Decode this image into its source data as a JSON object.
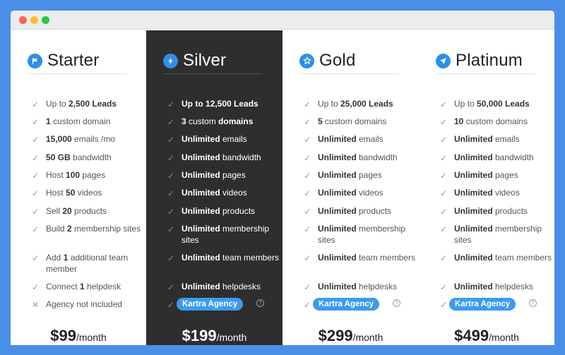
{
  "colors": {
    "background": "#4a8fe7",
    "accent": "#2d8fe6",
    "dark_column": "#2e2e2e"
  },
  "plans": [
    {
      "name": "Starter",
      "icon": "flag-icon",
      "price": "$99",
      "period": "/month",
      "features": [
        {
          "icon": "check-icon",
          "pre": "Up to ",
          "bold": "2,500 Leads",
          "post": ""
        },
        {
          "icon": "check-icon",
          "pre": "",
          "bold": "1",
          "post": " custom domain"
        },
        {
          "icon": "check-icon",
          "pre": "",
          "bold": "15,000",
          "post": " emails /mo"
        },
        {
          "icon": "check-icon",
          "pre": "",
          "bold": "50 GB",
          "post": " bandwidth"
        },
        {
          "icon": "check-icon",
          "pre": "Host ",
          "bold": "100",
          "post": " pages"
        },
        {
          "icon": "check-icon",
          "pre": "Host ",
          "bold": "50",
          "post": " videos"
        },
        {
          "icon": "check-icon",
          "pre": "Sell ",
          "bold": "20",
          "post": " products"
        },
        {
          "icon": "check-icon",
          "pre": "Build ",
          "bold": "2",
          "post": " membership sites"
        },
        {
          "icon": "check-icon",
          "pre": "Add ",
          "bold": "1",
          "post": " additional team member"
        },
        {
          "icon": "check-icon",
          "pre": "Connect ",
          "bold": "1",
          "post": " helpdesk"
        },
        {
          "icon": "cross-icon",
          "pre": "Agency not included",
          "bold": "",
          "post": ""
        }
      ]
    },
    {
      "name": "Silver",
      "icon": "bolt-icon",
      "price": "$199",
      "period": "/month",
      "features": [
        {
          "icon": "check-icon",
          "pre": "",
          "bold": "Up to 12,500 Leads",
          "post": ""
        },
        {
          "icon": "check-icon",
          "pre": "",
          "bold": "3",
          "post": " custom ",
          "bold2": "domains"
        },
        {
          "icon": "check-icon",
          "pre": "",
          "bold": "Unlimited",
          "post": " emails"
        },
        {
          "icon": "check-icon",
          "pre": "",
          "bold": "Unlimited",
          "post": " bandwidth"
        },
        {
          "icon": "check-icon",
          "pre": "",
          "bold": "Unlimited",
          "post": " pages"
        },
        {
          "icon": "check-icon",
          "pre": "",
          "bold": "Unlimited",
          "post": " videos"
        },
        {
          "icon": "check-icon",
          "pre": "",
          "bold": "Unlimited",
          "post": " products"
        },
        {
          "icon": "check-icon",
          "pre": "",
          "bold": "Unlimited",
          "post": " membership sites"
        },
        {
          "icon": "check-icon",
          "pre": "",
          "bold": "Unlimited",
          "post": " team members"
        },
        {
          "icon": "check-icon",
          "pre": "",
          "bold": "Unlimited",
          "post": " helpdesks"
        }
      ],
      "agency": "Kartra Agency"
    },
    {
      "name": "Gold",
      "icon": "star-icon",
      "price": "$299",
      "period": "/month",
      "features": [
        {
          "icon": "check-icon",
          "pre": "Up to ",
          "bold": "25,000 Leads",
          "post": ""
        },
        {
          "icon": "check-icon",
          "pre": "",
          "bold": "5",
          "post": " custom domains"
        },
        {
          "icon": "check-icon",
          "pre": "",
          "bold": "Unlimited",
          "post": " emails"
        },
        {
          "icon": "check-icon",
          "pre": "",
          "bold": "Unlimited",
          "post": " bandwidth"
        },
        {
          "icon": "check-icon",
          "pre": "",
          "bold": "Unlimited",
          "post": " pages"
        },
        {
          "icon": "check-icon",
          "pre": "",
          "bold": "Unlimited",
          "post": " videos"
        },
        {
          "icon": "check-icon",
          "pre": "",
          "bold": "Unlimited",
          "post": " products"
        },
        {
          "icon": "check-icon",
          "pre": "",
          "bold": "Unlimited",
          "post": " membership sites"
        },
        {
          "icon": "check-icon",
          "pre": "",
          "bold": "Unlimited",
          "post": " team members"
        },
        {
          "icon": "check-icon",
          "pre": "",
          "bold": "Unlimited",
          "post": " helpdesks"
        }
      ],
      "agency": "Kartra Agency"
    },
    {
      "name": "Platinum",
      "icon": "rocket-icon",
      "price": "$499",
      "period": "/month",
      "features": [
        {
          "icon": "check-icon",
          "pre": "Up to ",
          "bold": "50,000 Leads",
          "post": ""
        },
        {
          "icon": "check-icon",
          "pre": "",
          "bold": "10",
          "post": " custom domains"
        },
        {
          "icon": "check-icon",
          "pre": "",
          "bold": "Unlimited",
          "post": " emails"
        },
        {
          "icon": "check-icon",
          "pre": "",
          "bold": "Unlimited",
          "post": " bandwidth"
        },
        {
          "icon": "check-icon",
          "pre": "",
          "bold": "Unlimited",
          "post": " pages"
        },
        {
          "icon": "check-icon",
          "pre": "",
          "bold": "Unlimited",
          "post": " videos"
        },
        {
          "icon": "check-icon",
          "pre": "",
          "bold": "Unlimited",
          "post": " products"
        },
        {
          "icon": "check-icon",
          "pre": "",
          "bold": "Unlimited",
          "post": " membership sites"
        },
        {
          "icon": "check-icon",
          "pre": "",
          "bold": "Unlimited",
          "post": " team members"
        },
        {
          "icon": "check-icon",
          "pre": "",
          "bold": "Unlimited",
          "post": " helpdesks"
        }
      ],
      "agency": "Kartra Agency"
    }
  ]
}
